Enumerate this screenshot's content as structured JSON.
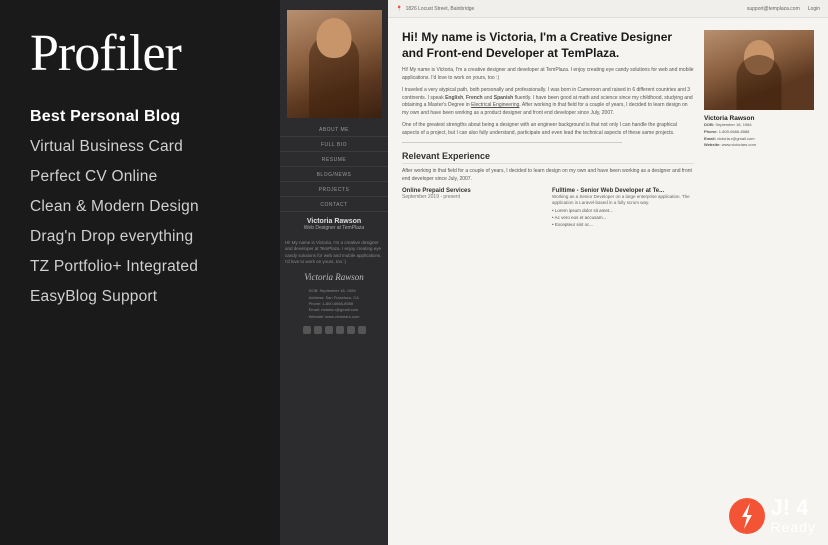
{
  "left": {
    "title": "Profiler",
    "features": [
      {
        "label": "Best Personal Blog",
        "highlight": true
      },
      {
        "label": "Virtual Business Card",
        "highlight": false
      },
      {
        "label": "Perfect CV Online",
        "highlight": false
      },
      {
        "label": "Clean & Modern Design",
        "highlight": false
      },
      {
        "label": "Drag'n Drop everything",
        "highlight": false
      },
      {
        "label": "TZ Portfolio+ Integrated",
        "highlight": false
      },
      {
        "label": "EasyBlog Support",
        "highlight": false
      }
    ]
  },
  "cv": {
    "topbar": {
      "address": "1826 Locust Street, Bainbridge",
      "support": "support@templaza.com",
      "login": "Login"
    },
    "name": "Victoria Rawson",
    "subtitle": "Web Designer at TemPlaza",
    "heading": "Hi! My name is Victoria, I'm a Creative Designer and Front-end Developer at TemPlaza.",
    "nav_items": [
      "ABOUT ME",
      "FULL BIO",
      "RESUME",
      "BLOG/NEWS",
      "PROJECTS",
      "CONTACT"
    ],
    "para1": "Hi! My name is Victoria, I'm a creative designer and developer at TemPlaza. I enjoy creating eye candy solutions for web and mobile applications. I'd love to work on yours, too :)",
    "para2": "I traveled a very atypical path, both personally and professionally. I was born in Cameroon and raised in 6 different countries and 3 continents. I speak English, French and Spanish fluently. I have been good at math and science since my childhood, studying and obtaining a Master's Degree in Electrical Engineering. After working in that field for a couple of years, I decided to learn design on my own and have been working as a product designer and front end developer since July, 2007.",
    "para3": "One of the greatest strengths about being a designer with an engineer background is that not only I can handle the graphical aspects of a project, but I can also fully understand, participate and even lead the technical aspects of these same projects.",
    "section_experience": "Relevant Experience",
    "exp_intro": "After working in that field for a couple of years, I decided to learn design on my own and have been working as a designer and front end developer since July, 2007.",
    "exp1_title": "Online Prepaid Services",
    "exp1_date": "September 2019 - present",
    "exp2_title": "Fulltime - Senior Web Developer at Te...",
    "exp2_date": "",
    "exp2_text": "Working as a Senior Developer on a large enterprise application. The application is Laravel-based in a fully scrum way.",
    "bullets": [
      "Lorem ipsum dolor sit amet...",
      "Ac vero eos et accusam...",
      "Excepteur sint oc..."
    ],
    "side_name": "Victoria Rawson",
    "side_dob_label": "DOB:",
    "side_dob": "September 18, 1984",
    "side_phone_label": "Phone:",
    "side_phone": "1-800-6666-8588",
    "side_email_label": "Email:",
    "side_email": "victoria.r@gmail.com",
    "side_website_label": "Website:",
    "side_website": "www.victoriars.com",
    "bio_text": "Hi! My name is Victoria, I'm a creative designer and developer at TemPlaza. I enjoy creating eye candy solutions for web and mobile applications. I'd love to work on yours, too :)",
    "signature": "Victoria Rawson",
    "contact_dob": "DOB: September 18, 1984",
    "contact_address": "Address: San Francisco, CA",
    "contact_phone": "Phone: 1-800-6666-8588",
    "contact_email": "Email: victoria.r@gmail.com",
    "contact_website": "Website: www.victoriars.com"
  },
  "joomla": {
    "version": "J! 4",
    "ready": "Ready"
  }
}
